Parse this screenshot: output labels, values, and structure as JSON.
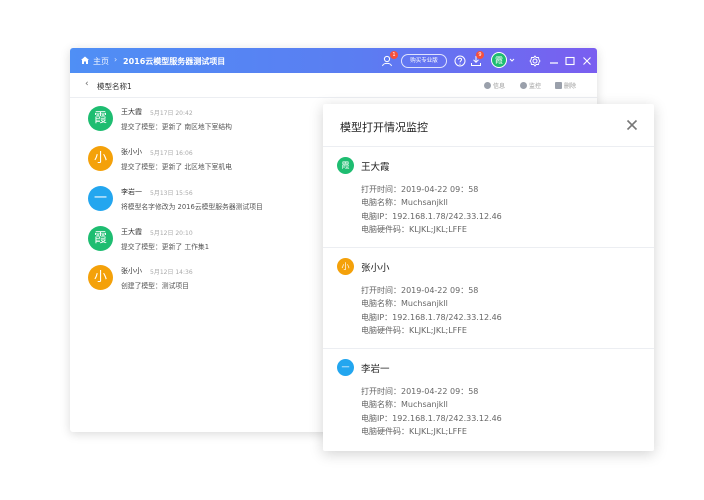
{
  "titlebar": {
    "home_label": "主页",
    "separator": "›",
    "project_title": "2016云模型服务器测试项目",
    "upgrade_label": "购买专业版",
    "members_badge": "1",
    "download_badge": "9",
    "user_avatar_char": "霞",
    "accent_color": "#5b7df2"
  },
  "subbar": {
    "back": "‹",
    "model_name": "模型名称1",
    "tools": [
      {
        "label": "信息",
        "icon": "info-icon"
      },
      {
        "label": "监控",
        "icon": "eye-icon"
      },
      {
        "label": "删除",
        "icon": "trash-icon"
      }
    ]
  },
  "activity": [
    {
      "avatar": "霞",
      "color": "#1ebd71",
      "name": "王大霞",
      "time": "5月17日 20:42",
      "text": "提交了模型：更新了 南区地下室结构"
    },
    {
      "avatar": "小",
      "color": "#f4a10a",
      "name": "张小小",
      "time": "5月17日 16:06",
      "text": "提交了模型：更新了 北区地下室机电"
    },
    {
      "avatar": "一",
      "color": "#23a6ef",
      "name": "李岩一",
      "time": "5月13日 15:56",
      "text": "将模型名字修改为 2016云模型服务器测试项目"
    },
    {
      "avatar": "霞",
      "color": "#1ebd71",
      "name": "王大霞",
      "time": "5月12日 20:10",
      "text": "提交了模型：更新了 工作集1"
    },
    {
      "avatar": "小",
      "color": "#f4a10a",
      "name": "张小小",
      "time": "5月12日 14:36",
      "text": "创建了模型：测试项目"
    }
  ],
  "panel": {
    "title": "模型打开情况监控",
    "sessions": [
      {
        "avatar": "霞",
        "color": "#1ebd71",
        "name": "王大霞",
        "open_time": "打开时间：2019-04-22 09：58",
        "pc_name": "电脑名称：Muchsanjkll",
        "pc_ip": "电脑IP：192.168.1.78/242.33.12.46",
        "hw_code": "电脑硬件码：KLJKL;JKL;LFFE"
      },
      {
        "avatar": "小",
        "color": "#f4a10a",
        "name": "张小小",
        "open_time": "打开时间：2019-04-22 09：58",
        "pc_name": "电脑名称：Muchsanjkll",
        "pc_ip": "电脑IP：192.168.1.78/242.33.12.46",
        "hw_code": "电脑硬件码：KLJKL;JKL;LFFE"
      },
      {
        "avatar": "一",
        "color": "#23a6ef",
        "name": "李岩一",
        "open_time": "打开时间：2019-04-22 09：58",
        "pc_name": "电脑名称：Muchsanjkll",
        "pc_ip": "电脑IP：192.168.1.78/242.33.12.46",
        "hw_code": "电脑硬件码：KLJKL;JKL;LFFE"
      }
    ]
  }
}
